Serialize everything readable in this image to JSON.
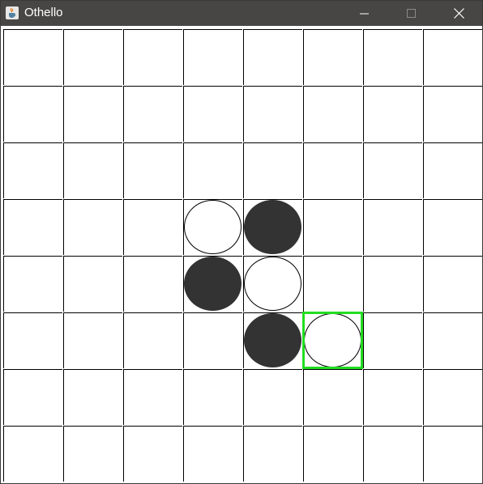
{
  "window": {
    "title": "Othello",
    "app_icon": "java-cup-icon",
    "controls": [
      "minimize-icon",
      "maximize-icon",
      "close-icon"
    ]
  },
  "board": {
    "rows": 8,
    "cols": 8,
    "grid_color": "#000000",
    "background": "#ffffff",
    "black_color": "#333333",
    "white_color": "#ffffff",
    "highlight_color": "#22dd22",
    "discs": [
      {
        "row": 3,
        "col": 3,
        "color": "white"
      },
      {
        "row": 3,
        "col": 4,
        "color": "black"
      },
      {
        "row": 4,
        "col": 3,
        "color": "black"
      },
      {
        "row": 4,
        "col": 4,
        "color": "white"
      },
      {
        "row": 5,
        "col": 4,
        "color": "black"
      },
      {
        "row": 5,
        "col": 5,
        "color": "white"
      }
    ],
    "highlighted_cell": {
      "row": 5,
      "col": 5
    }
  }
}
